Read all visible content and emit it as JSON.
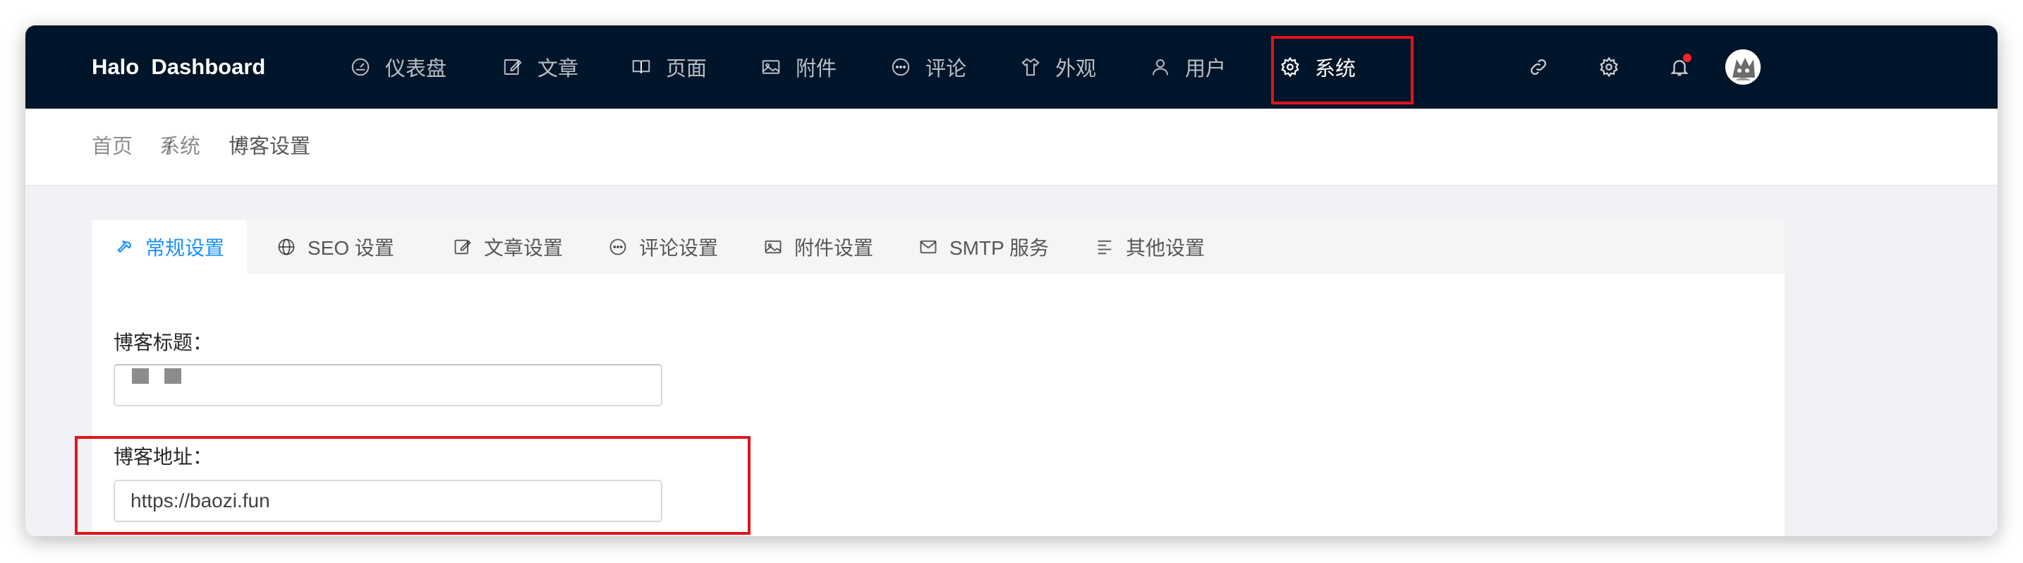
{
  "app": {
    "logo": "Halo  Dashboard"
  },
  "nav": {
    "items": [
      {
        "label": "仪表盘",
        "icon": "dashboard-icon"
      },
      {
        "label": "文章",
        "icon": "edit-icon"
      },
      {
        "label": "页面",
        "icon": "book-icon"
      },
      {
        "label": "附件",
        "icon": "picture-icon"
      },
      {
        "label": "评论",
        "icon": "comment-icon"
      },
      {
        "label": "外观",
        "icon": "shirt-icon"
      },
      {
        "label": "用户",
        "icon": "user-icon"
      },
      {
        "label": "系统",
        "icon": "setting-icon",
        "active": true
      }
    ],
    "right_icons": [
      "link-icon",
      "setting-icon",
      "bell-icon",
      "avatar"
    ]
  },
  "breadcrumb": {
    "items": [
      "首页",
      "系统",
      "博客设置"
    ],
    "separator": "/"
  },
  "tabs": [
    {
      "label": "常规设置",
      "icon": "tool-icon",
      "active": true
    },
    {
      "label": "SEO 设置",
      "icon": "global-icon"
    },
    {
      "label": "文章设置",
      "icon": "form-icon"
    },
    {
      "label": "评论设置",
      "icon": "message-icon"
    },
    {
      "label": "附件设置",
      "icon": "picture-icon"
    },
    {
      "label": "SMTP 服务",
      "icon": "mail-icon"
    },
    {
      "label": "其他设置",
      "icon": "align-left-icon"
    }
  ],
  "form": {
    "blog_title_label": "博客标题：",
    "blog_title_value": "",
    "blog_url_label": "博客地址：",
    "blog_url_value": "https://baozi.fun"
  },
  "colors": {
    "nav_bg": "#001529",
    "accent": "#1890ff",
    "highlight": "#e0151b",
    "notify": "#f5222d"
  }
}
